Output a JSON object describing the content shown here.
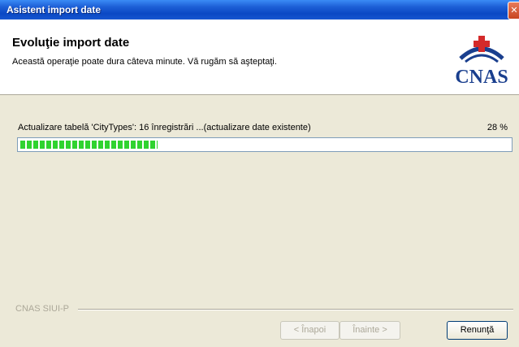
{
  "window": {
    "title": "Asistent import date",
    "close_glyph": "✕"
  },
  "header": {
    "title": "Evoluţie import date",
    "subtitle": "Această operaţie poate dura câteva minute. Vă rugăm să aşteptaţi.",
    "logo_text": "CNAS",
    "logo_icon": "cnas-logo-icon"
  },
  "progress": {
    "status": "Actualizare tabelă 'CityTypes': 16 înregistrări ...(actualizare date existente)",
    "percent_label": "28 %",
    "value": 0.28,
    "color": "#2fd32f"
  },
  "footer": {
    "group_label": "CNAS SIUI-P",
    "back_label": "< Înapoi",
    "next_label": "Înainte >",
    "cancel_label": "Renunţă"
  }
}
